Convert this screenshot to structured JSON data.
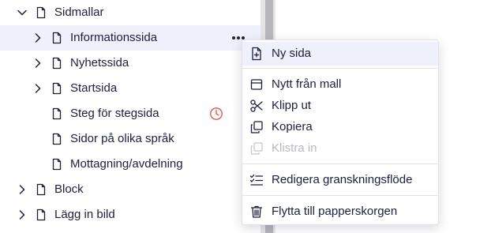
{
  "tree": {
    "items": [
      {
        "label": "Sidmallar",
        "expanded": true
      },
      {
        "label": "Informationssida",
        "selected": true
      },
      {
        "label": "Nyhetssida"
      },
      {
        "label": "Startsida"
      },
      {
        "label": "Steg för stegsida",
        "status_icon": "clock-icon"
      },
      {
        "label": "Sidor på olika språk"
      },
      {
        "label": "Mottagning/avdelning"
      },
      {
        "label": "Block"
      },
      {
        "label": "Lägg in bild"
      }
    ]
  },
  "context_menu": {
    "items": [
      {
        "label": "Ny sida",
        "icon": "new-page-icon",
        "hover": true
      },
      {
        "label": "Nytt från mall",
        "icon": "template-icon"
      },
      {
        "label": "Klipp ut",
        "icon": "scissors-icon"
      },
      {
        "label": "Kopiera",
        "icon": "copy-icon"
      },
      {
        "label": "Klistra in",
        "icon": "paste-icon",
        "disabled": true
      },
      {
        "label": "Redigera granskningsflöde",
        "icon": "checklist-icon"
      },
      {
        "label": "Flytta till papperskorgen",
        "icon": "trash-icon"
      }
    ]
  },
  "colors": {
    "text": "#1b1f3b",
    "selected_bg": "#eef0fb",
    "disabled_text": "#b6b8c4",
    "clock_accent": "#e05a4e"
  }
}
